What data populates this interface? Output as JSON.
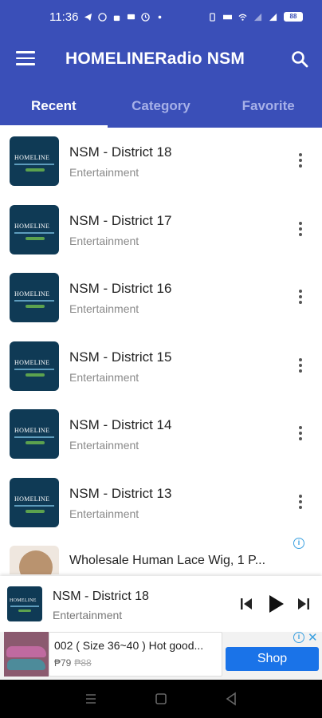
{
  "status_bar": {
    "time": "11:36",
    "battery": "88"
  },
  "app_bar": {
    "title": "HOMELINERadio NSM"
  },
  "tabs": [
    {
      "label": "Recent",
      "active": true
    },
    {
      "label": "Category",
      "active": false
    },
    {
      "label": "Favorite",
      "active": false
    }
  ],
  "stations": [
    {
      "title": "NSM - District 18",
      "category": "Entertainment"
    },
    {
      "title": "NSM - District 17",
      "category": "Entertainment"
    },
    {
      "title": "NSM - District 16",
      "category": "Entertainment"
    },
    {
      "title": "NSM - District 15",
      "category": "Entertainment"
    },
    {
      "title": "NSM - District 14",
      "category": "Entertainment"
    },
    {
      "title": "NSM - District 13",
      "category": "Entertainment"
    }
  ],
  "native_ad": {
    "title": "Wholesale Human Lace Wig, 1 P..."
  },
  "player": {
    "title": "NSM - District 18",
    "category": "Entertainment"
  },
  "banner_ad": {
    "title": "002 ( Size 36~40 ) Hot good...",
    "price": "₱79",
    "old_price": "₱88",
    "button": "Shop"
  },
  "colors": {
    "primary": "#3a4fb8",
    "accent": "#1a73e8",
    "thumb_bg": "#0f3a55"
  },
  "icons": {
    "menu": "menu-icon",
    "search": "search-icon",
    "more": "more-vert-icon",
    "prev": "skip-previous-icon",
    "play": "play-icon",
    "next": "skip-next-icon"
  }
}
